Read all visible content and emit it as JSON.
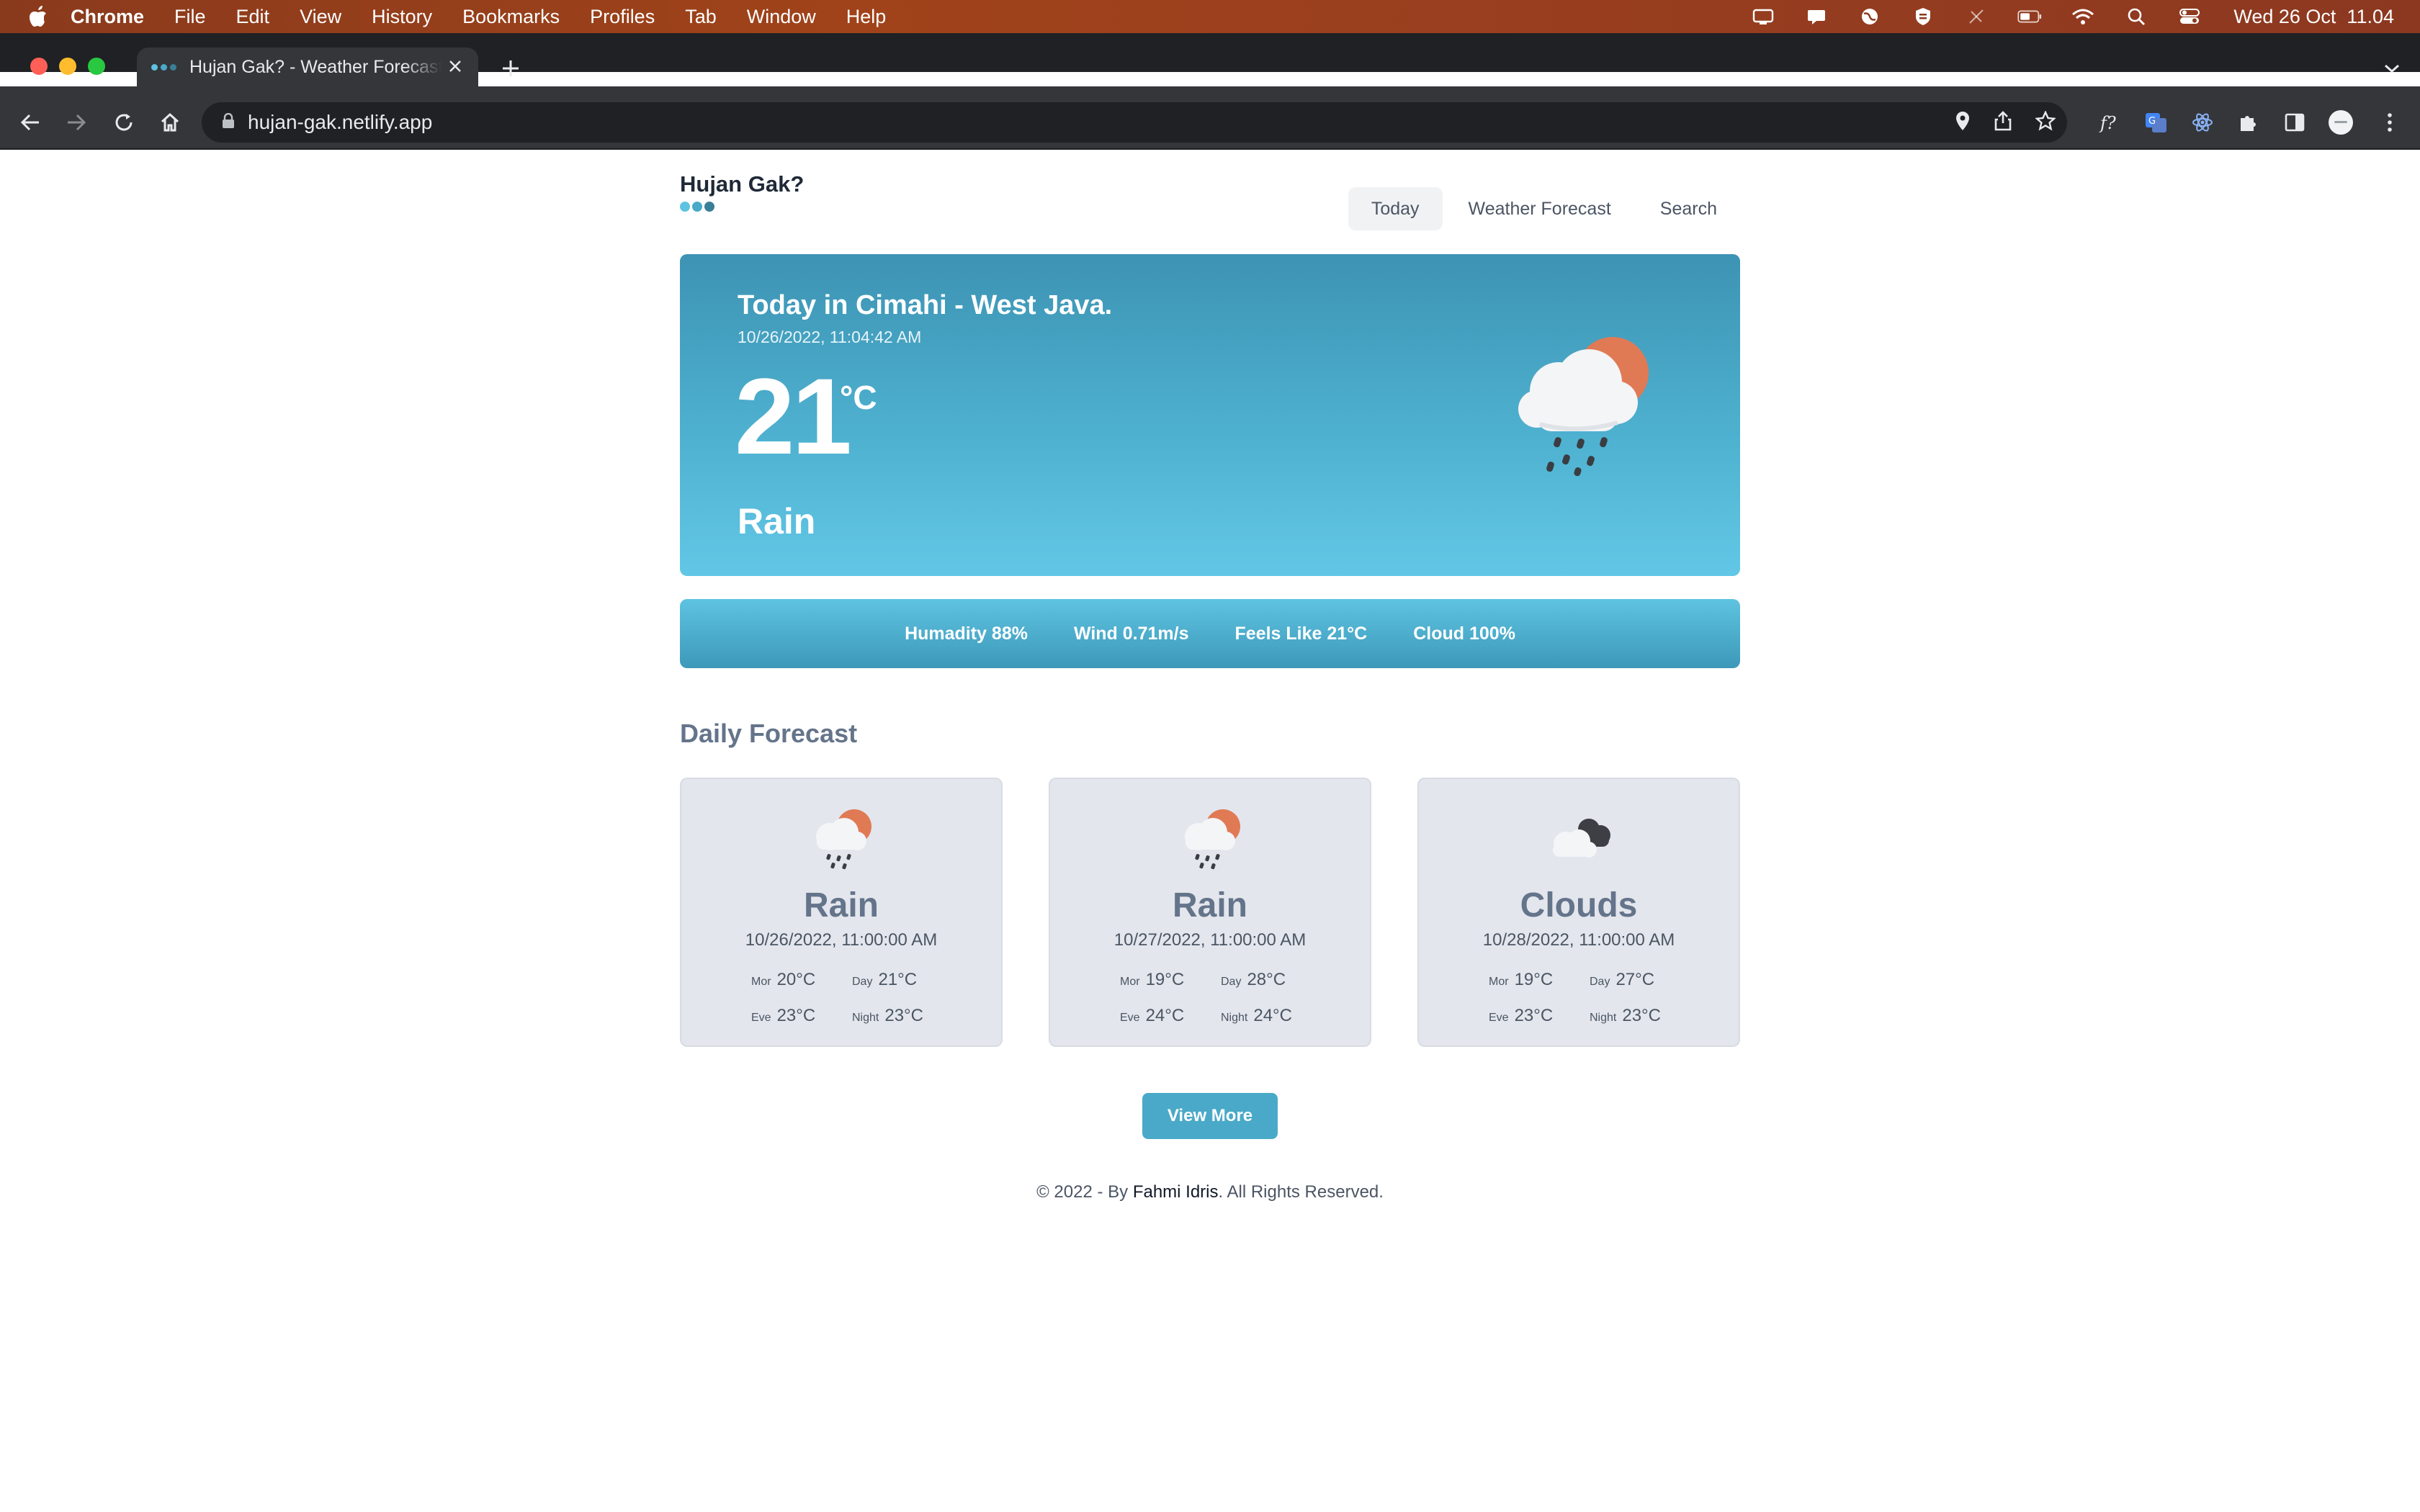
{
  "menubar": {
    "app": "Chrome",
    "items": [
      "File",
      "Edit",
      "View",
      "History",
      "Bookmarks",
      "Profiles",
      "Tab",
      "Window",
      "Help"
    ],
    "clock": "Wed 26 Oct  11.04"
  },
  "browser": {
    "tab_title": "Hujan Gak? - Weather Forecast",
    "url": "hujan-gak.netlify.app",
    "colors": {
      "close": "#ff5f57",
      "minimize": "#febc2e",
      "zoom": "#28c840"
    }
  },
  "site": {
    "brand": "Hujan Gak?",
    "nav": [
      "Today",
      "Weather Forecast",
      "Search"
    ],
    "active_nav": "Today"
  },
  "today": {
    "title": "Today in Cimahi - West Java.",
    "datetime": "10/26/2022, 11:04:42 AM",
    "temp": "21",
    "unit": "°C",
    "condition": "Rain"
  },
  "stats": [
    "Humadity 88%",
    "Wind 0.71m/s",
    "Feels Like 21°C",
    "Cloud 100%"
  ],
  "daily": {
    "title": "Daily Forecast",
    "cards": [
      {
        "icon": "rain-icon",
        "condition": "Rain",
        "date": "10/26/2022, 11:00:00 AM",
        "mor_label": "Mor",
        "mor": "20°C",
        "day_label": "Day",
        "day": "21°C",
        "eve_label": "Eve",
        "eve": "23°C",
        "night_label": "Night",
        "night": "23°C"
      },
      {
        "icon": "rain-icon",
        "condition": "Rain",
        "date": "10/27/2022, 11:00:00 AM",
        "mor_label": "Mor",
        "mor": "19°C",
        "day_label": "Day",
        "day": "28°C",
        "eve_label": "Eve",
        "eve": "24°C",
        "night_label": "Night",
        "night": "24°C"
      },
      {
        "icon": "clouds-icon",
        "condition": "Clouds",
        "date": "10/28/2022, 11:00:00 AM",
        "mor_label": "Mor",
        "mor": "19°C",
        "day_label": "Day",
        "day": "27°C",
        "eve_label": "Eve",
        "eve": "23°C",
        "night_label": "Night",
        "night": "23°C"
      }
    ],
    "view_more": "View More"
  },
  "footer": {
    "prefix": "© 2022 - By ",
    "author": "Fahmi Idris",
    "suffix": ". All Rights Reserved."
  },
  "colors": {
    "accent": "#4aa9c8",
    "sun": "#e07a55",
    "brand_dots": [
      "#5ec3e1",
      "#4aa9c8",
      "#3a7f98"
    ]
  }
}
